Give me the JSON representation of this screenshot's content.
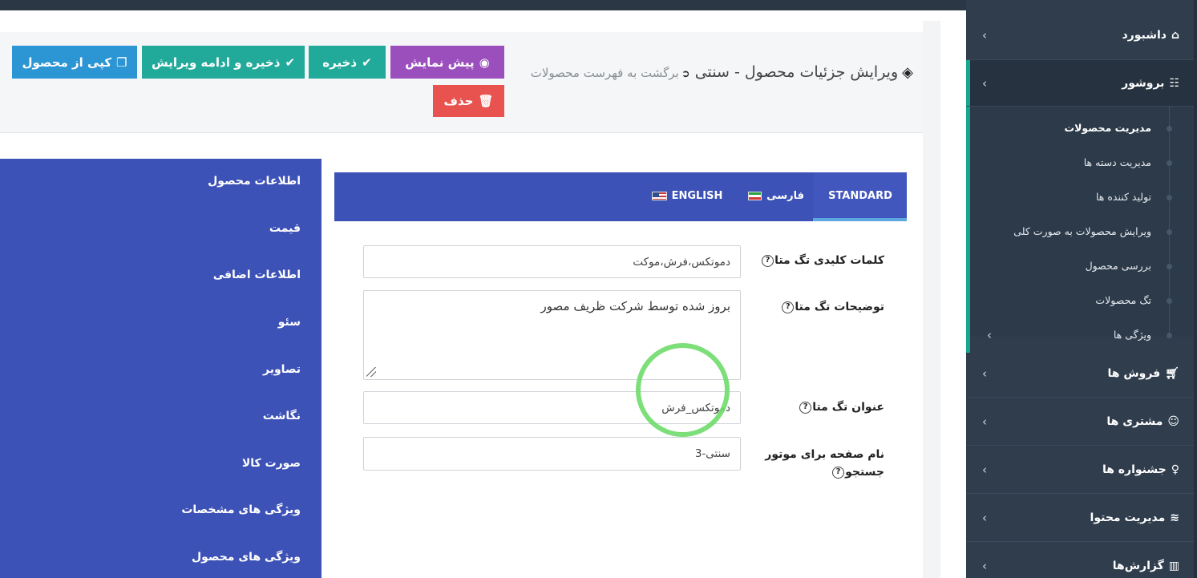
{
  "sidebar": {
    "dashboard": "داشبورد",
    "brochure": "بروشور",
    "sub_items": [
      "مدیریت محصولات",
      "مدیریت دسته ها",
      "تولید کننده ها",
      "ویرایش محصولات به صورت کلی",
      "بررسی محصول",
      "تگ محصولات",
      "ویژگی ها"
    ],
    "sales": "فروش ها",
    "customers": "مشتری ها",
    "festivals": "جشنواره ها",
    "content": "مدیریت محتوا",
    "reports": "گزارش‌ها",
    "chevron": "‹"
  },
  "header": {
    "title": "ویرایش جزئیات محصول - سنتی",
    "back_link": "برگشت به فهرست محصولات",
    "buttons": {
      "copy": "کپی از محصول",
      "save_continue": "ذخیره و ادامه ویرایش",
      "save": "ذخیره",
      "preview": "پیش نمایش",
      "delete": "حذف"
    }
  },
  "left_nav": [
    "اطلاعات محصول",
    "قیمت",
    "اطلاعات اضافی",
    "سئو",
    "تصاویر",
    "نگاشت",
    "صورت کالا",
    "ویژگی های مشخصات",
    "ویژگی های محصول"
  ],
  "tabs": {
    "standard": "STANDARD",
    "farsi": "فارسی",
    "english": "ENGLISH"
  },
  "form": {
    "meta_keywords_label": "کلمات کلیدی تگ متا",
    "meta_keywords_value": "دموتکس،فرش،موکت",
    "meta_description_label": "توضیحات تگ متا",
    "meta_description_value": "بروز شده توسط شرکت ظریف مصور",
    "meta_title_label": "عنوان تگ متا",
    "meta_title_value": "دموتکس_فرش",
    "seo_name_label": "نام صفحه برای موتور جستجو",
    "seo_name_value": "سنتی-3",
    "help_mark": "?"
  },
  "colors": {
    "sidebar_bg": "#2f3d4d",
    "accent_teal": "#17a68f",
    "nav_blue": "#3d52b6",
    "save_green": "#21a99a",
    "copy_blue": "#2c95d3",
    "preview_purple": "#9b4fbc",
    "delete_red": "#e8534f"
  }
}
